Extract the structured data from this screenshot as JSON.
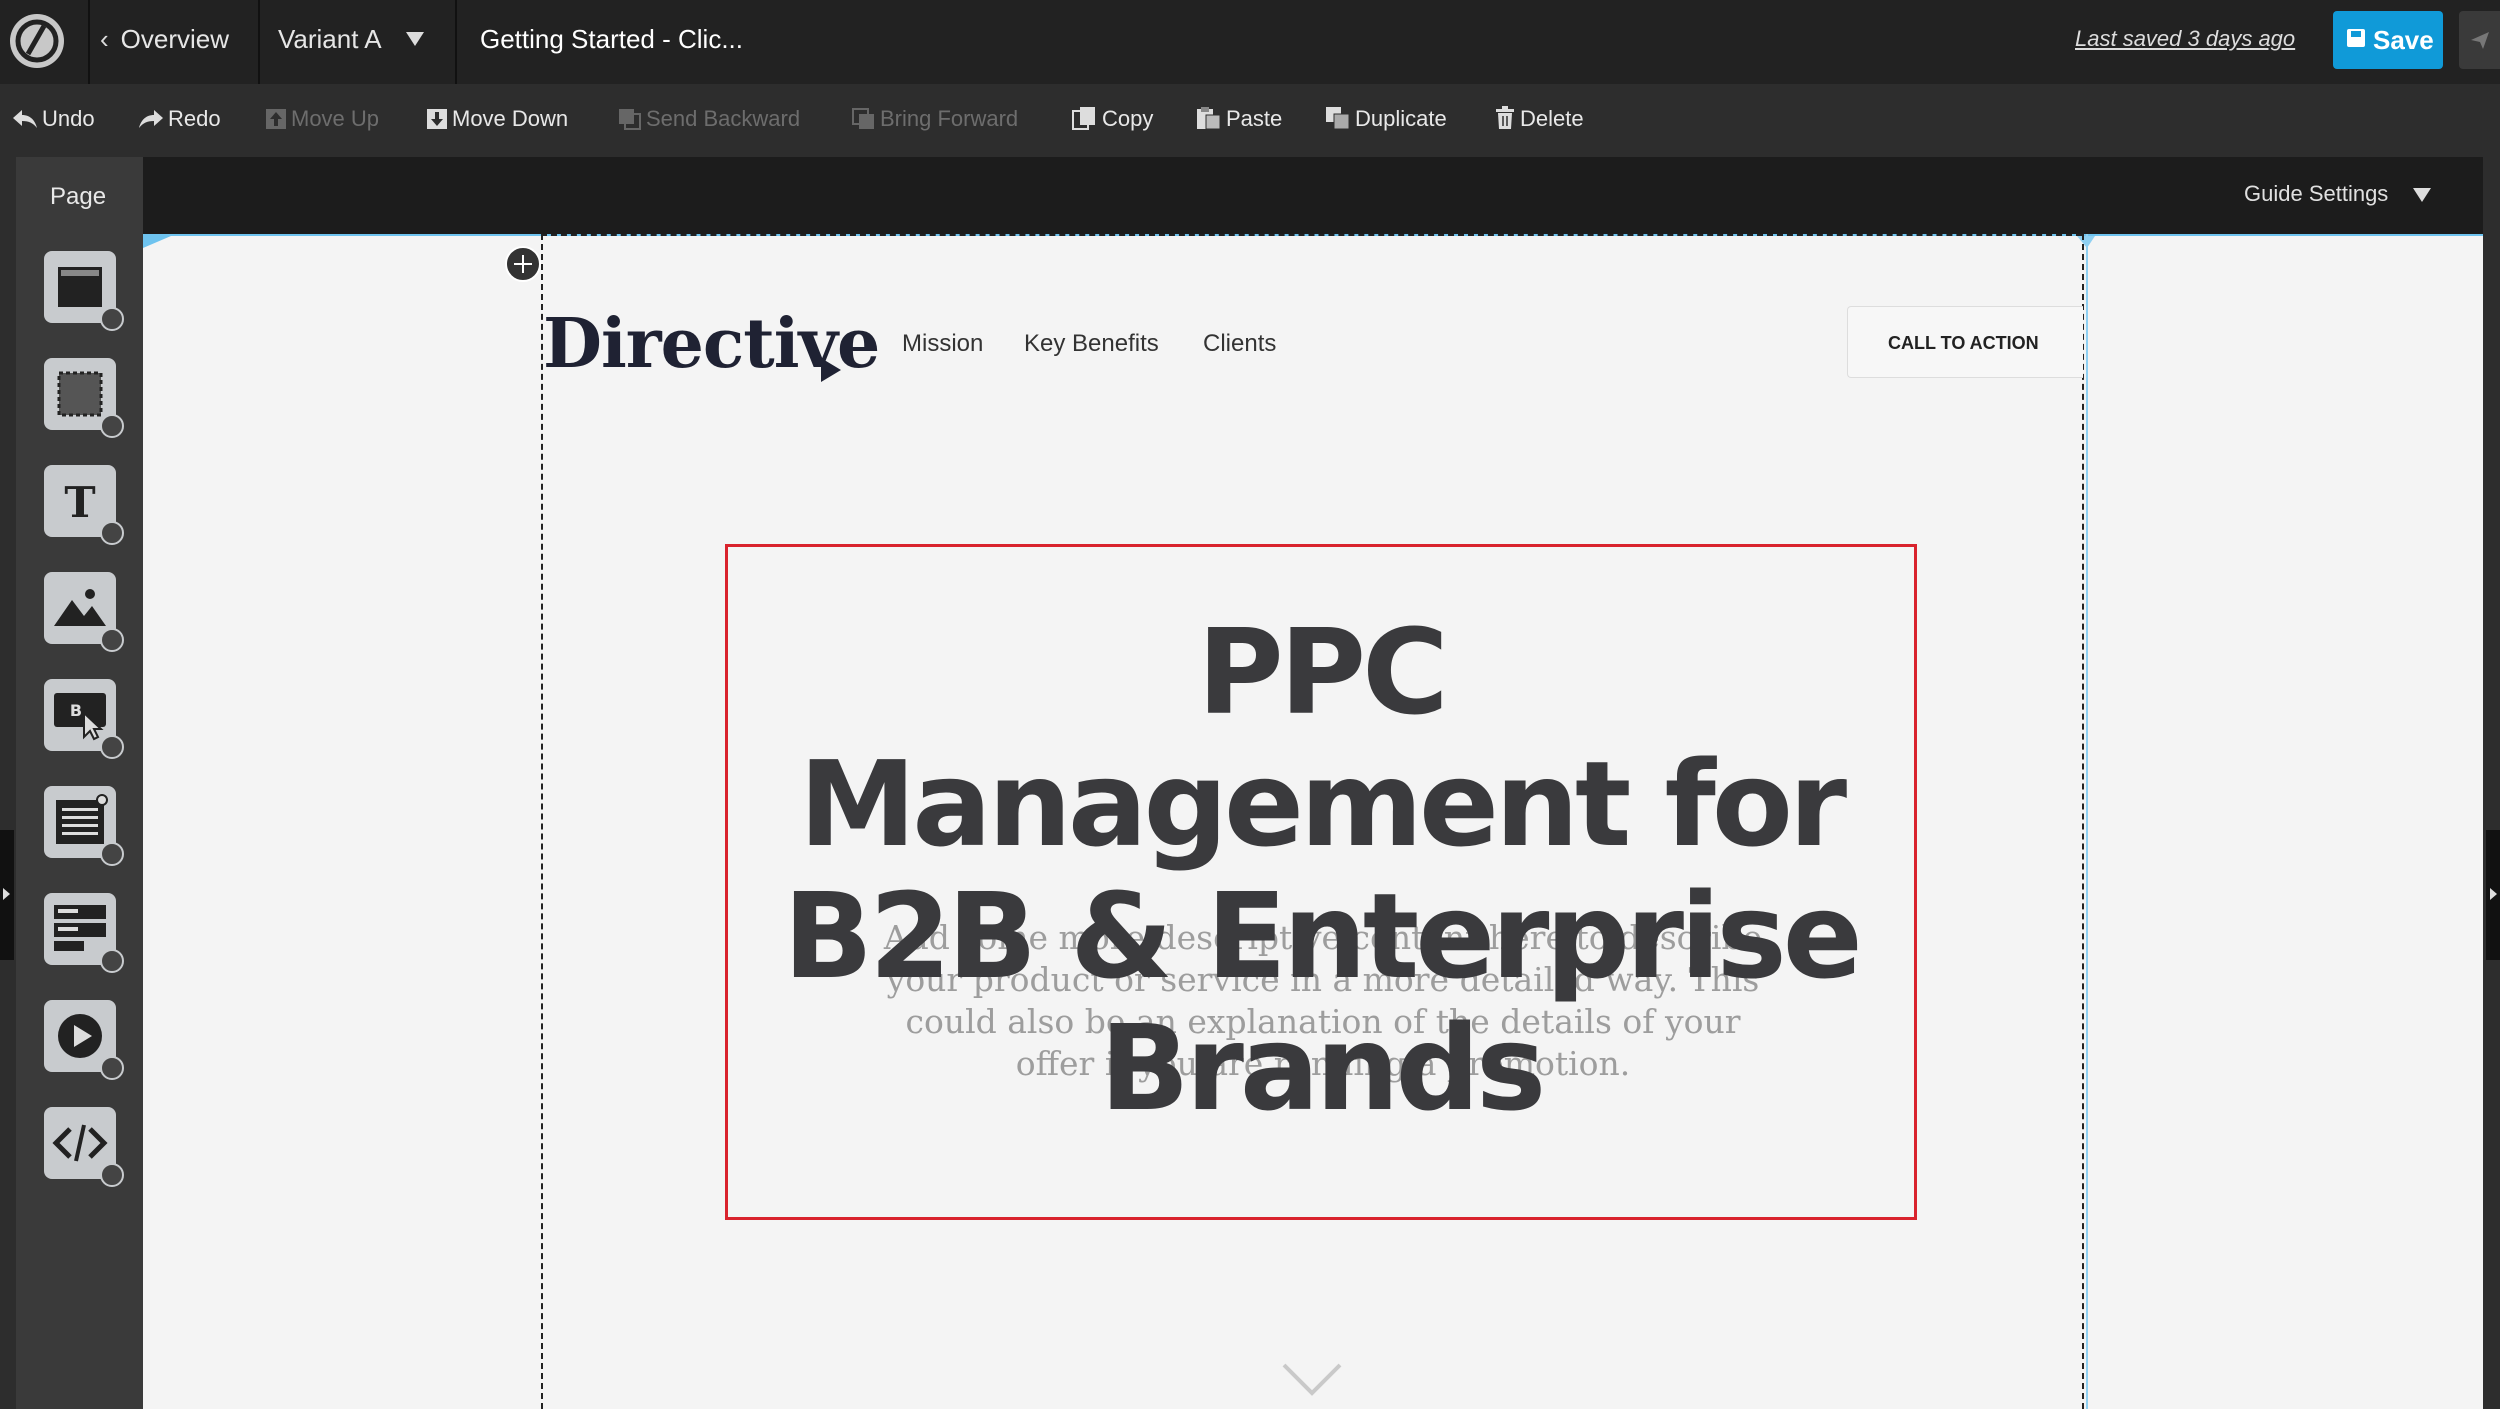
{
  "topbar": {
    "overview_label": "Overview",
    "variant_label": "Variant A",
    "page_name": "Getting Started - Clic...",
    "last_saved": "Last saved  3 days ago",
    "save_label": "Save"
  },
  "toolbar": {
    "undo": "Undo",
    "redo": "Redo",
    "move_up": "Move Up",
    "move_down": "Move Down",
    "send_backward": "Send Backward",
    "bring_forward": "Bring Forward",
    "copy": "Copy",
    "paste": "Paste",
    "duplicate": "Duplicate",
    "delete": "Delete"
  },
  "sidebar": {
    "tab_label": "Page",
    "tools": [
      {
        "icon": "section-icon"
      },
      {
        "icon": "box-icon"
      },
      {
        "icon": "text-icon"
      },
      {
        "icon": "image-icon"
      },
      {
        "icon": "button-icon"
      },
      {
        "icon": "form-icon"
      },
      {
        "icon": "social-widget-icon"
      },
      {
        "icon": "video-icon"
      },
      {
        "icon": "custom-html-icon"
      }
    ]
  },
  "guide": {
    "settings_label": "Guide Settings"
  },
  "canvas": {
    "brand": "Directive",
    "nav": [
      "Mission",
      "Key Benefits",
      "Clients"
    ],
    "cta_label": "CALL TO ACTION",
    "hero_title_lines": [
      "PPC",
      "Management for",
      "B2B & Enterprise",
      "Brands"
    ],
    "hero_description": "Add some more descriptive content here to describe your product or service in a more detailed way. This could also be an explanation of the details of your offer if you are running a promotion."
  },
  "colors": {
    "save_button": "#109ad8",
    "selection_border": "#d9232d",
    "guide_blue": "#6ec3ef"
  }
}
